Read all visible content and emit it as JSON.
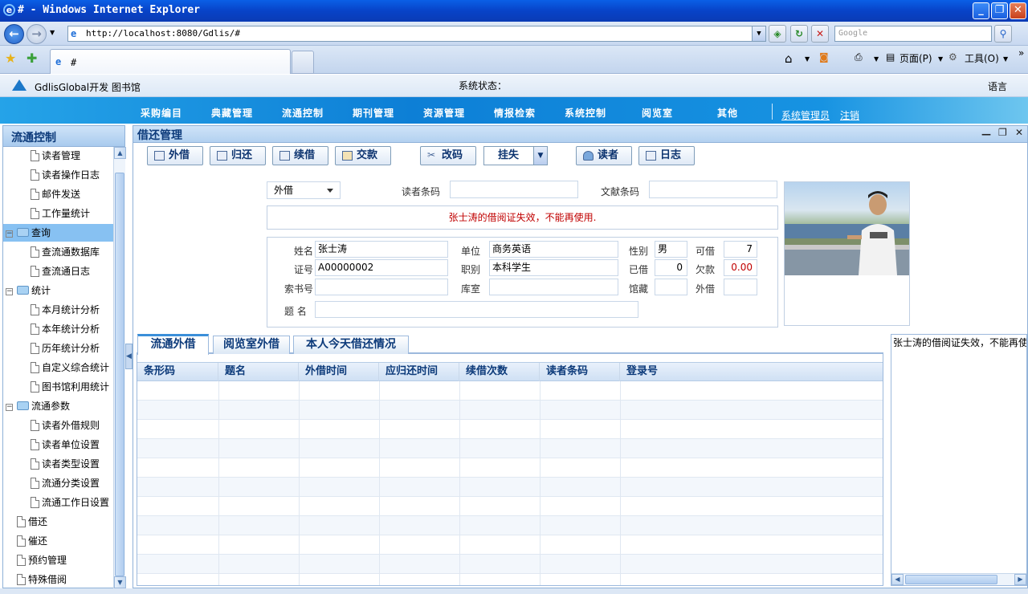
{
  "browser": {
    "title": "# - Windows Internet Explorer",
    "url": "http://localhost:8080/Gdlis/#",
    "search_placeholder": "Google",
    "tab_label": "#",
    "page_menu": "页面(P)",
    "tools_menu": "工具(O)"
  },
  "app": {
    "brand": "GdlisGlobal开发 图书馆",
    "status_label": "系统状态：",
    "language": "语言",
    "menu": [
      "采购编目",
      "典藏管理",
      "流通控制",
      "期刊管理",
      "资源管理",
      "情报检索",
      "系统控制",
      "阅览室",
      "其他"
    ],
    "user": "系统管理员",
    "logout": "注销"
  },
  "sidebar": {
    "title": "流通控制",
    "items": [
      {
        "label": "读者管理"
      },
      {
        "label": "读者操作日志"
      },
      {
        "label": "邮件发送"
      },
      {
        "label": "工作量统计"
      },
      {
        "label": "查询"
      },
      {
        "label": "查流通数据库"
      },
      {
        "label": "查流通日志"
      },
      {
        "label": "统计"
      },
      {
        "label": "本月统计分析"
      },
      {
        "label": "本年统计分析"
      },
      {
        "label": "历年统计分析"
      },
      {
        "label": "自定义综合统计"
      },
      {
        "label": "图书馆利用统计"
      },
      {
        "label": "流通参数"
      },
      {
        "label": "读者外借规则"
      },
      {
        "label": "读者单位设置"
      },
      {
        "label": "读者类型设置"
      },
      {
        "label": "流通分类设置"
      },
      {
        "label": "流通工作日设置"
      },
      {
        "label": "借还"
      },
      {
        "label": "催还"
      },
      {
        "label": "预约管理"
      },
      {
        "label": "特殊借阅"
      }
    ]
  },
  "panel": {
    "title": "借还管理",
    "toolbar": {
      "lend": "外借",
      "return": "归还",
      "renew": "续借",
      "pay": "交款",
      "edit_code": "改码",
      "lost": "挂失",
      "reader": "读者",
      "log": "日志"
    },
    "form": {
      "mode_value": "外借",
      "reader_barcode_label": "读者条码",
      "reader_barcode_value": "",
      "doc_barcode_label": "文献条码",
      "doc_barcode_value": "",
      "message": "张士涛的借阅证失效，不能再使用.",
      "name_label": "姓名",
      "name_value": "张士涛",
      "unit_label": "单位",
      "unit_value": "商务英语",
      "gender_label": "性别",
      "gender_value": "男",
      "can_borrow_label": "可借",
      "can_borrow_value": "7",
      "card_label": "证号",
      "card_value": "A00000002",
      "role_label": "职别",
      "role_value": "本科学生",
      "borrowed_label": "已借",
      "borrowed_value": "0",
      "owed_label": "欠款",
      "owed_value": "0.00",
      "callno_label": "索书号",
      "callno_value": "",
      "room_label": "库室",
      "room_value": "",
      "collection_label": "馆藏",
      "collection_value": "",
      "lent_label": "外借",
      "lent_value": "",
      "title_label": "题 名",
      "title_value": ""
    },
    "tabs": [
      "流通外借",
      "阅览室外借",
      "本人今天借还情况"
    ],
    "grid_headers": [
      "条形码",
      "题名",
      "外借时间",
      "应归还时间",
      "续借次数",
      "读者条码",
      "登录号"
    ],
    "side_message": "张士涛的借阅证失效，不能再使用."
  },
  "colors": {
    "nav_blue": "#0d7fd6",
    "message_red": "#c00000",
    "selected_item": "#87c1f2"
  }
}
